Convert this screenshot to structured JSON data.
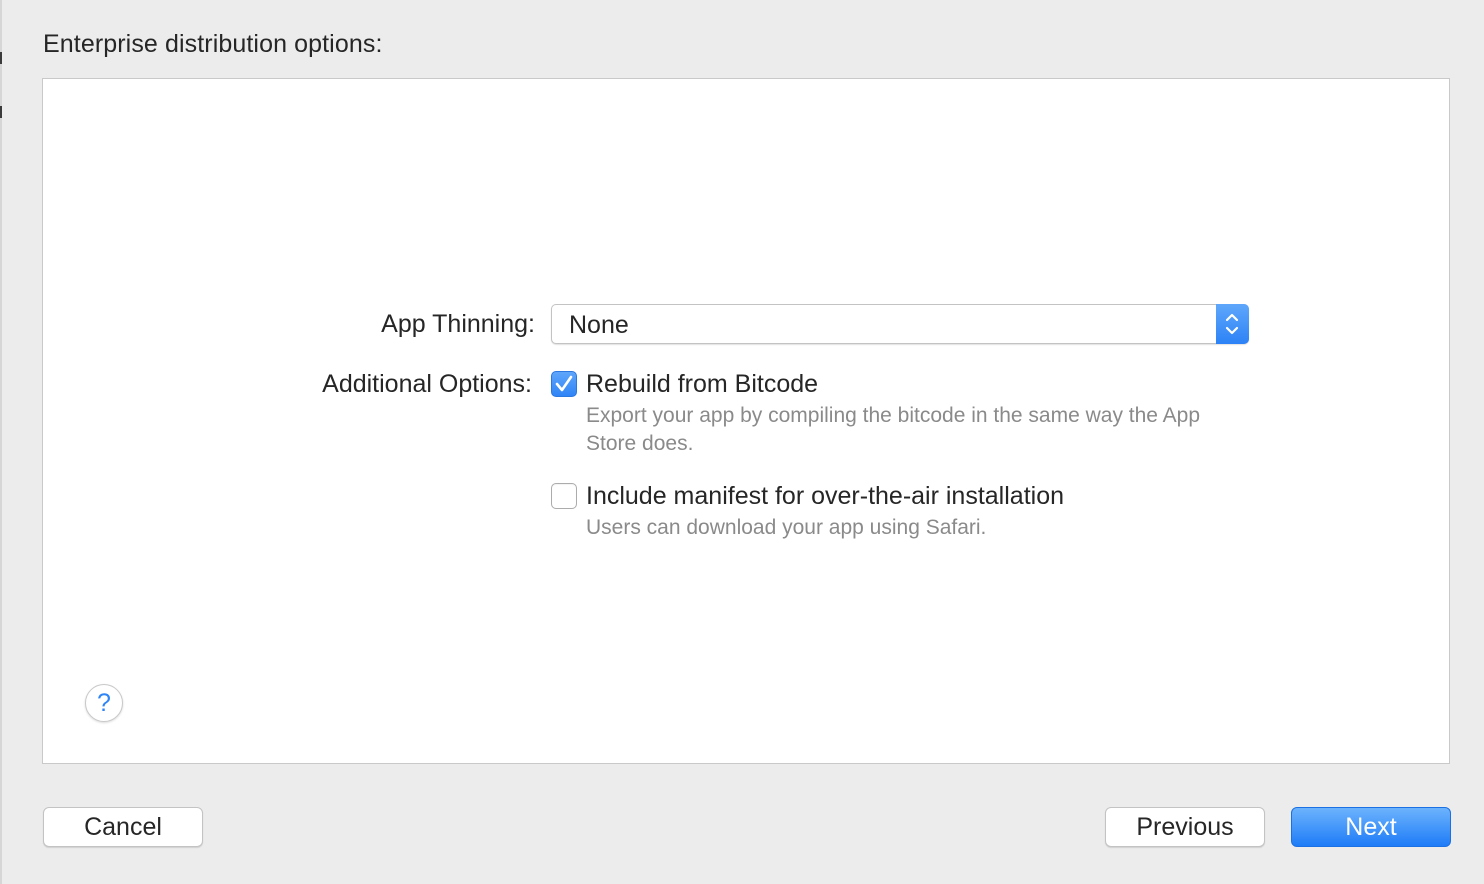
{
  "header": {
    "title": "Enterprise distribution options:"
  },
  "options": {
    "app_thinning": {
      "label": "App Thinning:",
      "selected": "None"
    },
    "additional_options_label": "Additional Options:",
    "rebuild_bitcode": {
      "label": "Rebuild from Bitcode",
      "checked": true,
      "description": "Export your app by compiling the bitcode in the same way the App Store does."
    },
    "include_manifest": {
      "label": "Include manifest for over-the-air installation",
      "checked": false,
      "description": "Users can download your app using Safari."
    }
  },
  "help": {
    "glyph": "?"
  },
  "footer": {
    "cancel_label": "Cancel",
    "previous_label": "Previous",
    "next_label": "Next"
  },
  "colors": {
    "accent": "#2f84f6",
    "background": "#ececec",
    "panel": "#ffffff",
    "secondary_text": "#8a8a8a"
  }
}
